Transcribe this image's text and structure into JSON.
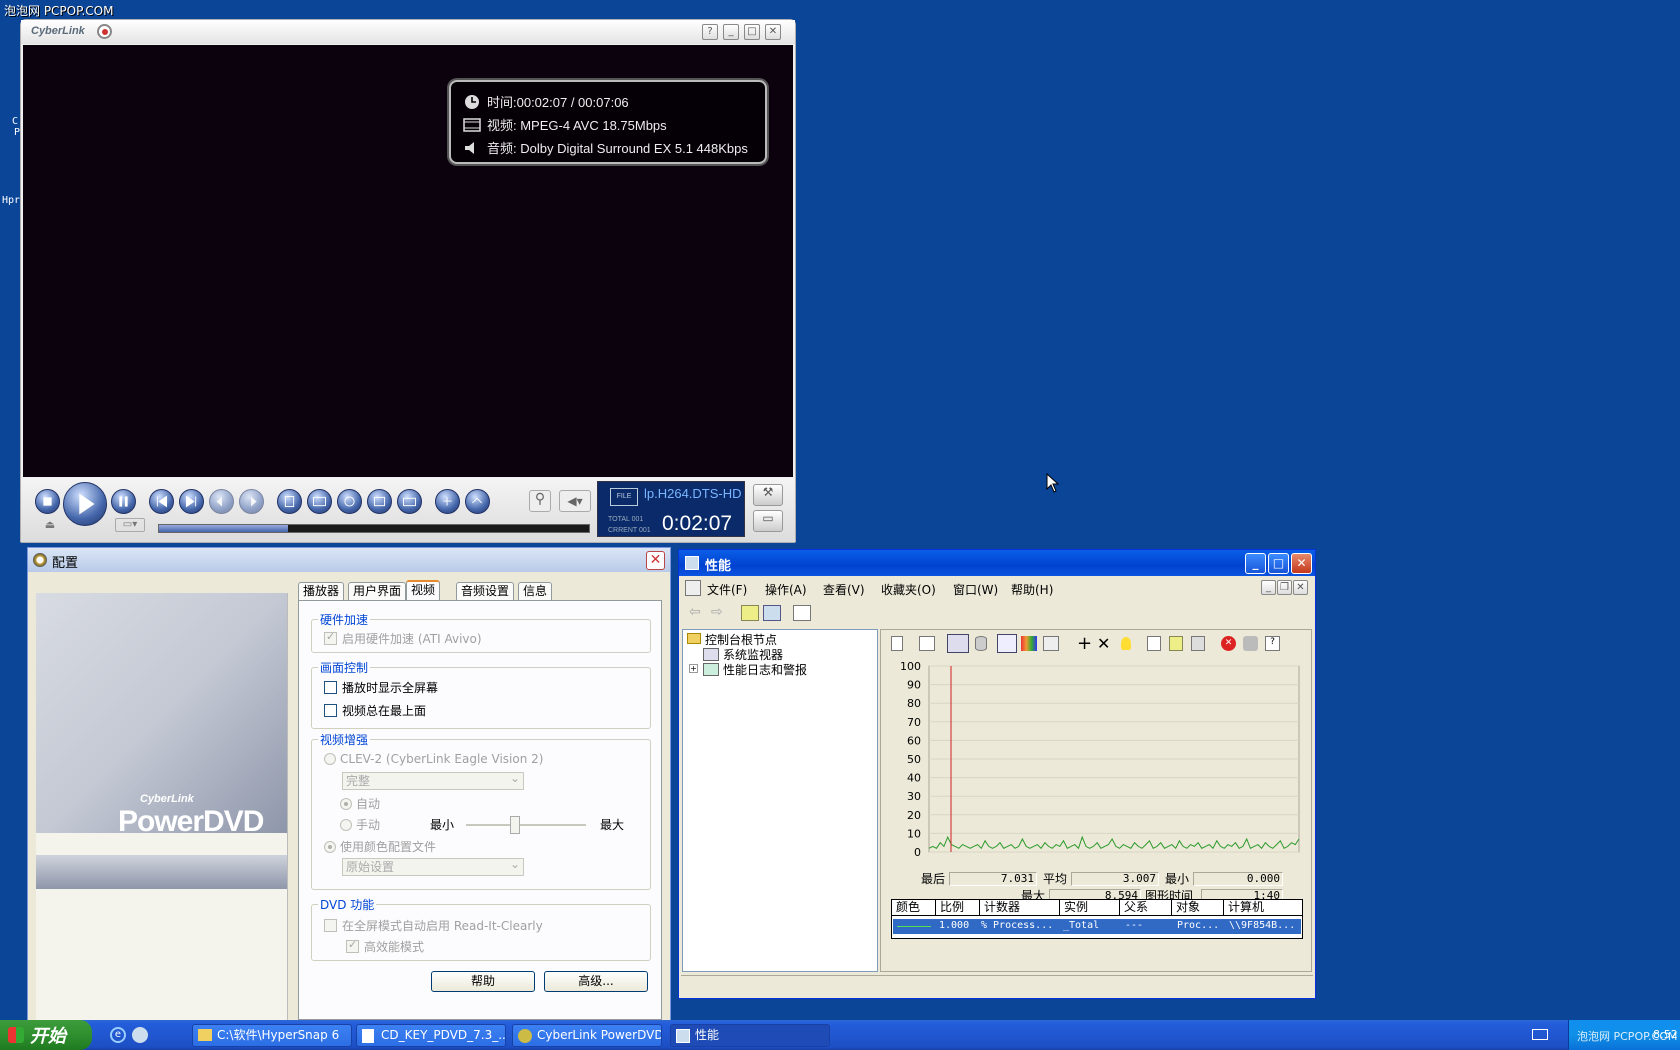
{
  "desktop": {
    "watermark": "泡泡网 PCPOP.COM",
    "frag1": "C",
    "frag2": "P",
    "frag3": "Hpr"
  },
  "pdvd": {
    "logo": "CyberLink",
    "osd": {
      "time": "时间:00:02:07 / 00:07:06",
      "video": "视频: MPEG-4 AVC 18.75Mbps",
      "audio": "音频: Dolby Digital Surround EX 5.1   448Kbps"
    },
    "lcd": {
      "file": "lp.H264.DTS-HD",
      "total": "TOTAL 001",
      "current": "CRRENT 001",
      "time": "0:02:07"
    },
    "progress": 0.3
  },
  "config": {
    "title": "配置",
    "brand_small": "CyberLink",
    "brand": "PowerDVD",
    "tabs": [
      "播放器",
      "用户界面",
      "视频",
      "音频设置",
      "信息"
    ],
    "active_tab": "视频",
    "hw_group": "硬件加速",
    "hw_enable": "启用硬件加速 (ATI Avivo)",
    "display_group": "画面控制",
    "fullscreen": "播放时显示全屏幕",
    "ontop": "视频总在最上面",
    "enhance_group": "视频增强",
    "clev": "CLEV-2 (CyberLink Eagle Vision 2)",
    "clev_mode": "完整",
    "auto": "自动",
    "manual": "手动",
    "min": "最小",
    "max": "最大",
    "use_profile": "使用颜色配置文件",
    "profile": "原始设置",
    "dvd_group": "DVD 功能",
    "ric": "在全屏模式自动启用 Read-It-Clearly",
    "hq": "高效能模式",
    "help": "帮助",
    "advanced": "高级..."
  },
  "perf": {
    "title": "性能",
    "menu": [
      "文件(F)",
      "操作(A)",
      "查看(V)",
      "收藏夹(O)",
      "窗口(W)",
      "帮助(H)"
    ],
    "tree_root": "控制台根节点",
    "tree_item1": "系统监视器",
    "tree_item2": "性能日志和警报",
    "stats": {
      "last_label": "最后",
      "last": "7.031",
      "avg_label": "平均",
      "avg": "3.007",
      "min_label": "最小",
      "min": "0.000",
      "max_label": "最大",
      "max": "8.594",
      "dur_label": "图形时间",
      "dur": "1:40"
    },
    "columns": [
      "颜色",
      "比例",
      "计数器",
      "实例",
      "父系",
      "对象",
      "计算机"
    ],
    "row": {
      "scale": "1.000",
      "counter": "% Process...",
      "instance": "_Total",
      "parent": "---",
      "object": "Proc...",
      "computer": "\\\\9F854B..."
    }
  },
  "chart_data": {
    "type": "line",
    "ylim": [
      0,
      100
    ],
    "yticks": [
      "100",
      "90",
      "80",
      "70",
      "60",
      "50",
      "40",
      "30",
      "20",
      "10",
      "0"
    ],
    "series": [
      {
        "values": [
          2,
          3,
          2,
          5,
          3,
          8,
          4,
          3,
          2,
          4,
          3,
          2,
          3,
          4,
          2,
          6,
          3,
          2,
          3,
          5,
          2,
          3,
          4,
          2,
          3,
          7,
          3,
          2,
          3,
          4,
          2,
          5,
          3,
          2,
          4,
          3,
          6,
          2,
          3,
          4,
          2,
          8,
          3,
          2,
          3,
          5,
          2,
          3,
          4,
          7,
          3,
          2,
          4,
          3,
          2,
          5,
          3,
          2,
          4,
          6,
          2,
          3,
          5,
          2,
          3,
          4,
          2,
          6,
          3,
          2,
          4,
          3,
          5,
          2,
          3,
          4,
          2,
          6,
          3,
          2,
          4,
          3,
          5,
          2,
          3,
          7,
          2,
          3,
          4,
          2,
          5,
          3,
          2,
          4,
          6,
          2,
          3,
          5,
          4,
          7
        ]
      }
    ]
  },
  "taskbar": {
    "start": "开始",
    "tasks": [
      "C:\\软件\\HyperSnap 6",
      "CD_KEY_PDVD_7.3_...",
      "CyberLink PowerDVD",
      "性能"
    ],
    "tray_text": "泡泡网 PCPOP.COM",
    "clock": "8:52"
  }
}
